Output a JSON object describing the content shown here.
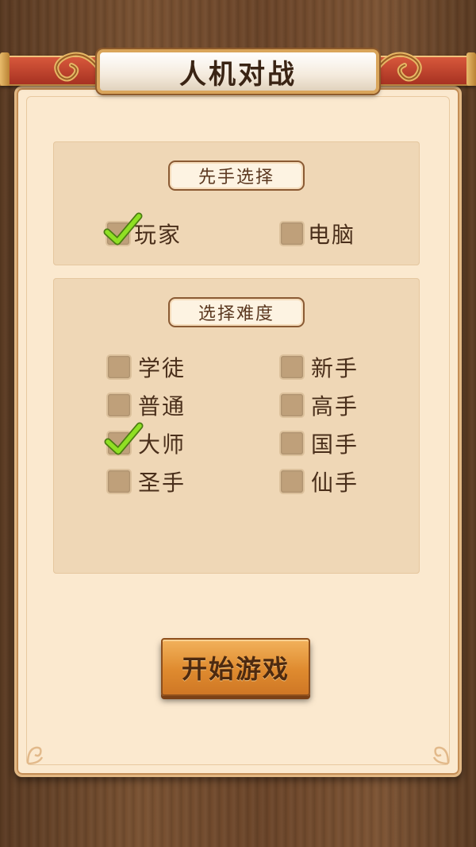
{
  "header": {
    "title": "人机对战"
  },
  "first_move": {
    "label": "先手选择",
    "options": [
      {
        "label": "玩家",
        "checked": true
      },
      {
        "label": "电脑",
        "checked": false
      }
    ]
  },
  "difficulty": {
    "label": "选择难度",
    "options": [
      {
        "label": "学徒",
        "checked": false
      },
      {
        "label": "新手",
        "checked": false
      },
      {
        "label": "普通",
        "checked": false
      },
      {
        "label": "高手",
        "checked": false
      },
      {
        "label": "大师",
        "checked": true
      },
      {
        "label": "国手",
        "checked": false
      },
      {
        "label": "圣手",
        "checked": false
      },
      {
        "label": "仙手",
        "checked": false
      }
    ]
  },
  "start_button": {
    "label": "开始游戏"
  },
  "colors": {
    "panel": "#fbe9cf",
    "section": "#efd7b6",
    "rail_red": "#c0402a",
    "check_green": "#7fcf1f",
    "button_orange": "#df8b2f"
  }
}
